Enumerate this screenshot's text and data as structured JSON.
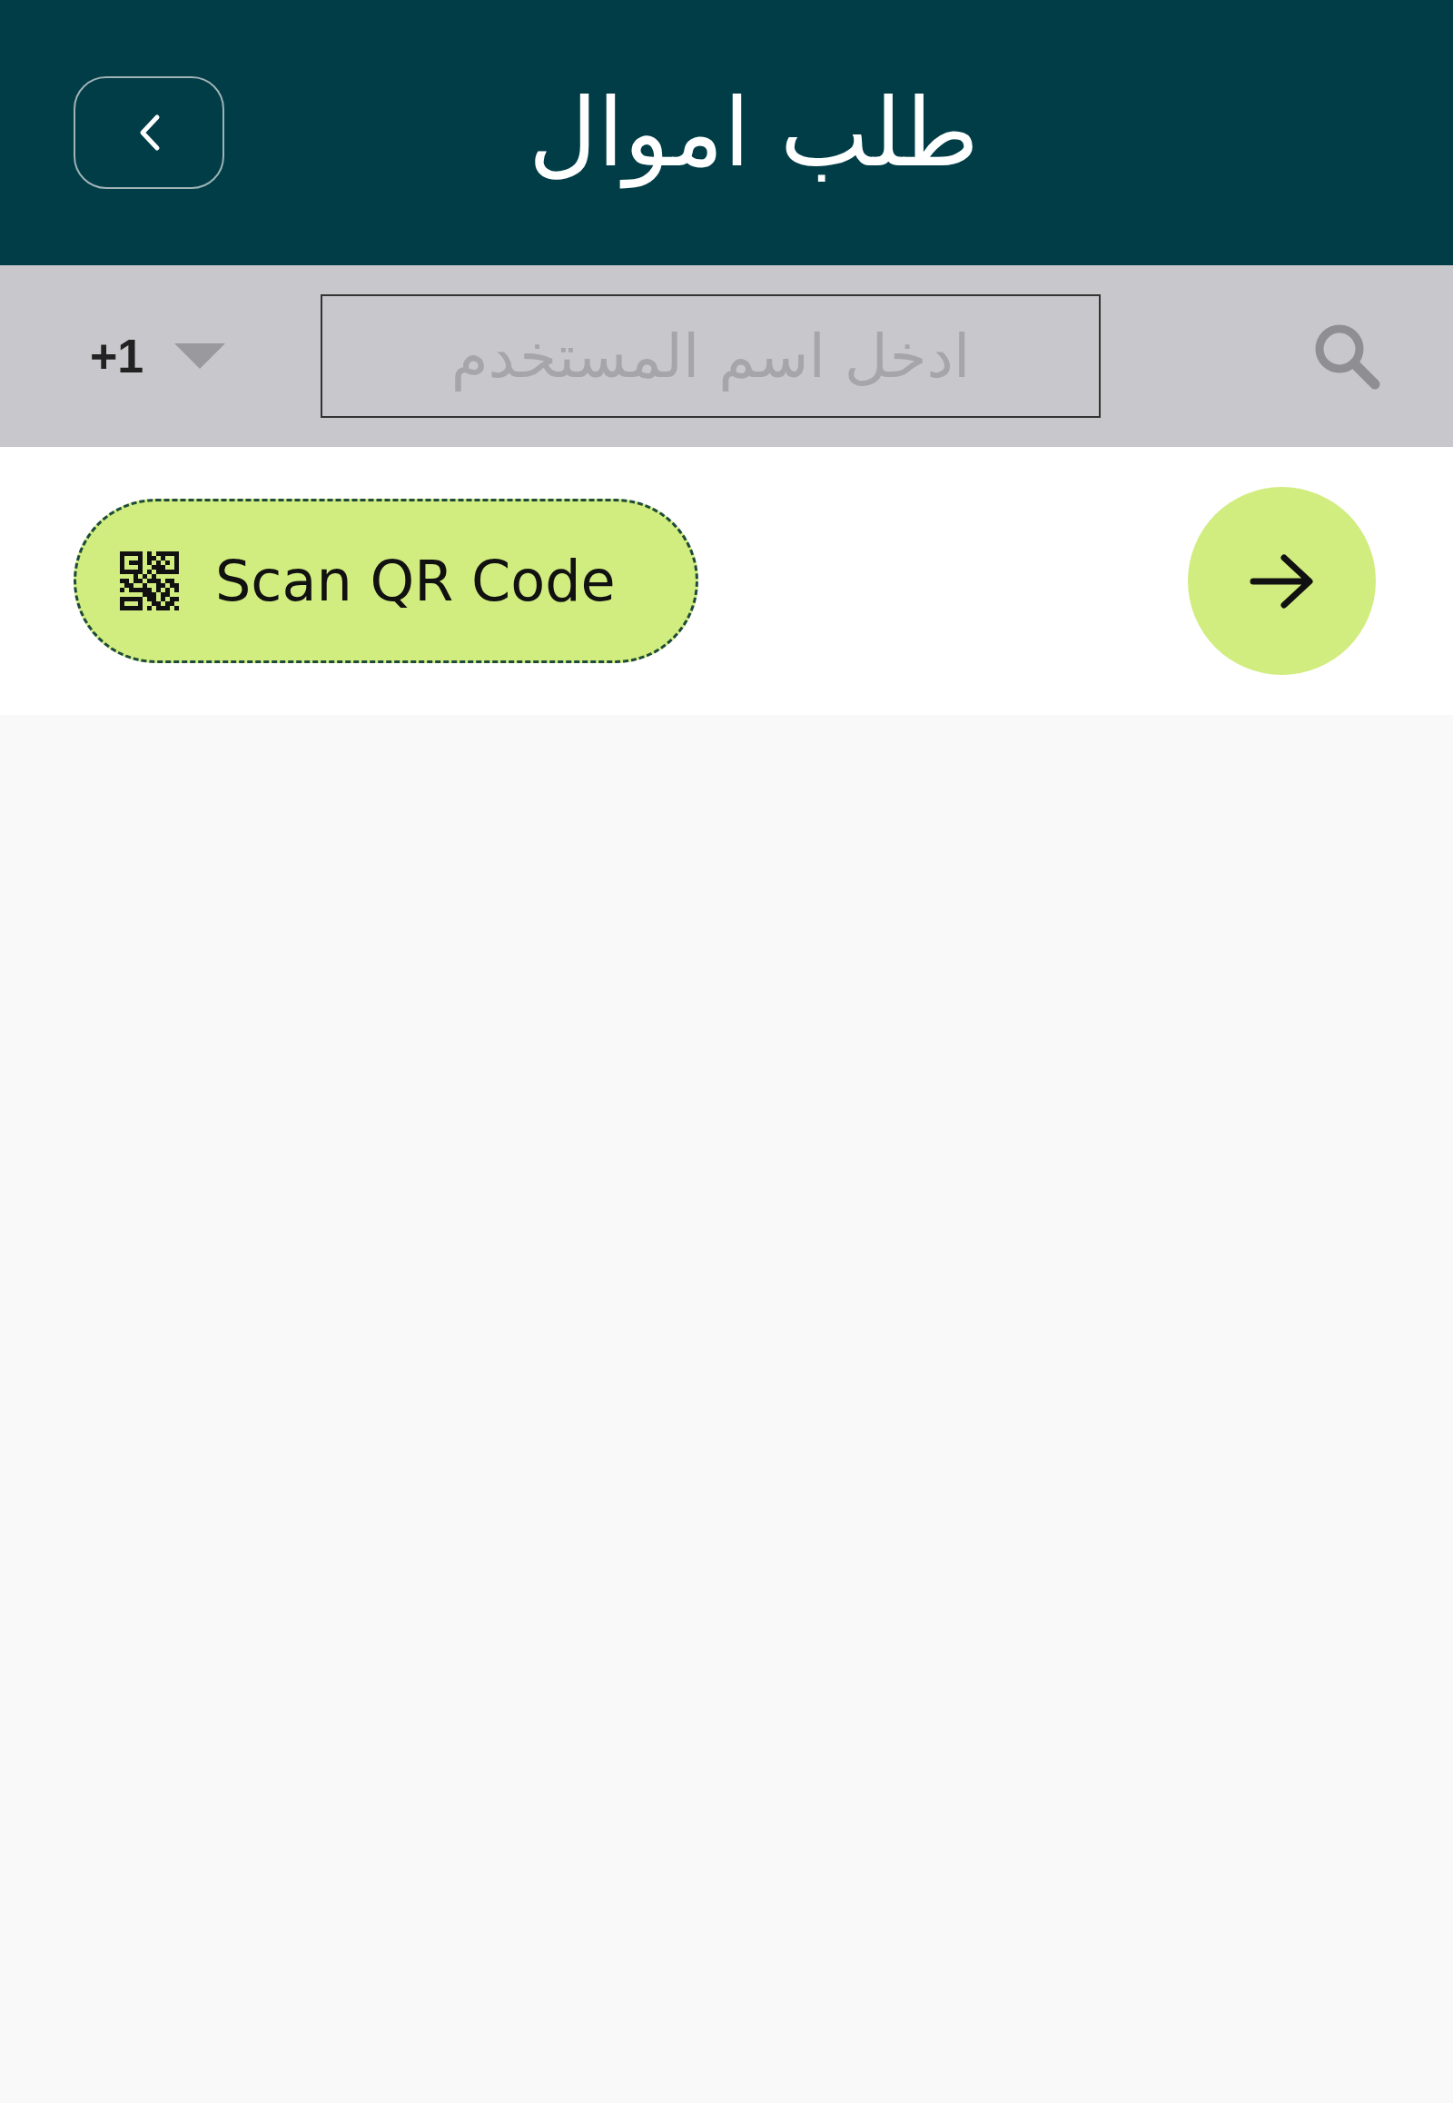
{
  "header": {
    "title": "طلب اموال"
  },
  "search_bar": {
    "country_code": "+1",
    "placeholder": "ادخل اسم المستخدم"
  },
  "actions": {
    "scan_button": {
      "label": "Scan QR Code"
    }
  }
}
